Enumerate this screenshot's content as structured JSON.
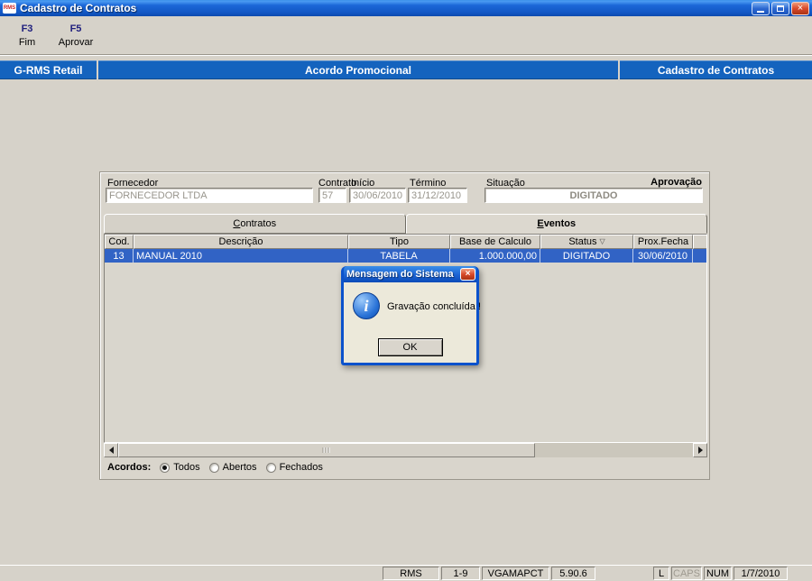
{
  "colors": {
    "desktop-gray": "#d6d2c9",
    "header-blue": "#1463be",
    "selected-row-blue": "#3163c5",
    "close-red": "#d8492a",
    "dialog-frame-blue": "#0a52cc",
    "dialog-body": "#ece9da"
  },
  "window": {
    "title": "Cadastro de Contratos",
    "icon_text": "RMS",
    "close_glyph": "×"
  },
  "toolbar": {
    "buttons": [
      {
        "key": "F3",
        "label": "Fim"
      },
      {
        "key": "F5",
        "label": "Aprovar"
      }
    ]
  },
  "header": {
    "left": "G-RMS Retail",
    "center": "Acordo Promocional",
    "right": "Cadastro de Contratos"
  },
  "form": {
    "fornecedor": {
      "label": "Fornecedor",
      "value": "FORNECEDOR LTDA"
    },
    "contrato": {
      "label": "Contrato",
      "value": "57"
    },
    "inicio": {
      "label": "Início",
      "value": "30/06/2010"
    },
    "termino": {
      "label": "Término",
      "value": "31/12/2010"
    },
    "situacao": {
      "label": "Situação",
      "value": "DIGITADO"
    },
    "aprovacao": {
      "label": "Aprovação"
    }
  },
  "tabs": [
    {
      "label": "Contratos",
      "active": false
    },
    {
      "label": "Eventos",
      "active": true
    }
  ],
  "table": {
    "columns": [
      "Cod.",
      "Descrição",
      "Tipo",
      "Base de Calculo",
      "Status",
      "Prox.Fecha"
    ],
    "sort_glyph": "▽",
    "rows": [
      {
        "cod": "13",
        "descricao": "MANUAL 2010",
        "tipo": "TABELA",
        "base": "1.000.000,00",
        "status": "DIGITADO",
        "prox": "30/06/2010",
        "selected": true
      }
    ]
  },
  "dialog": {
    "title": "Mensagem do Sistema",
    "message": "Gravação concluída !",
    "ok_label": "OK",
    "close_glyph": "×"
  },
  "filter": {
    "label": "Acordos:",
    "options": [
      {
        "label": "Todos",
        "selected": true
      },
      {
        "label": "Abertos",
        "selected": false
      },
      {
        "label": "Fechados",
        "selected": false
      }
    ]
  },
  "statusbar": {
    "cells": [
      {
        "label": "RMS"
      },
      {
        "label": "1-9"
      },
      {
        "label": "VGAMAPCT"
      },
      {
        "label": "5.90.6"
      },
      {
        "label": "L"
      },
      {
        "label": "CAPS",
        "disabled": true
      },
      {
        "label": "NUM"
      },
      {
        "label": "1/7/2010"
      }
    ]
  }
}
